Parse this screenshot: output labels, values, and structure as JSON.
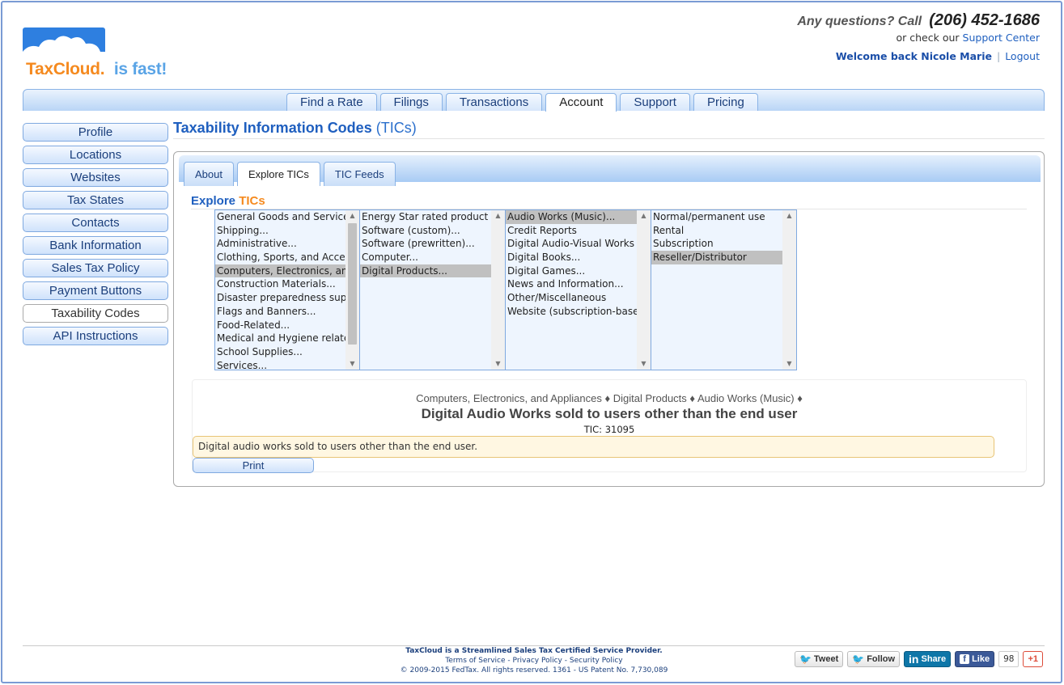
{
  "header": {
    "brand_tax": "TaxCloud",
    "brand_reg": ".",
    "brand_tagline": "is fast!",
    "questions": "Any questions? Call",
    "phone": "(206) 452-1686",
    "check_prefix": "or check our",
    "support_center": "Support Center",
    "welcome": "Welcome back Nicole Marie",
    "logout": "Logout"
  },
  "nav": {
    "tabs": [
      {
        "label": "Find a Rate"
      },
      {
        "label": "Filings"
      },
      {
        "label": "Transactions"
      },
      {
        "label": "Account"
      },
      {
        "label": "Support"
      },
      {
        "label": "Pricing"
      }
    ],
    "active": "Account"
  },
  "sidebar": {
    "items": [
      {
        "label": "Profile"
      },
      {
        "label": "Locations"
      },
      {
        "label": "Websites"
      },
      {
        "label": "Tax States"
      },
      {
        "label": "Contacts"
      },
      {
        "label": "Bank Information"
      },
      {
        "label": "Sales Tax Policy"
      },
      {
        "label": "Payment Buttons"
      },
      {
        "label": "Taxability Codes"
      },
      {
        "label": "API Instructions"
      }
    ],
    "active": "Taxability Codes"
  },
  "main": {
    "title": "Taxability Information Codes",
    "title_suffix": "(TICs)",
    "subtabs": [
      {
        "label": "About"
      },
      {
        "label": "Explore TICs"
      },
      {
        "label": "TIC Feeds"
      }
    ],
    "active_subtab": "Explore TICs",
    "explore_prefix": "Explore",
    "explore_suffix": "TICs"
  },
  "lists": {
    "col1": [
      "General Goods and Services",
      "Shipping...",
      "Administrative...",
      "Clothing, Sports, and Acces",
      "Computers, Electronics, anc",
      "Construction Materials...",
      "Disaster preparedness suppl",
      "Flags and Banners...",
      "Food-Related...",
      "Medical and Hygiene relate",
      "School Supplies...",
      "Services..."
    ],
    "col1_selected": 4,
    "col2": [
      "Energy Star rated product",
      "Software (custom)...",
      "Software (prewritten)...",
      "Computer...",
      "Digital Products..."
    ],
    "col2_selected": 4,
    "col3": [
      "Audio Works (Music)...",
      "Credit Reports",
      "Digital Audio-Visual Works",
      "Digital Books...",
      "Digital Games...",
      "News and Information...",
      "Other/Miscellaneous",
      "Website (subscription-basec"
    ],
    "col3_selected": 0,
    "col4": [
      "Normal/permanent use",
      "Rental",
      "Subscription",
      "Reseller/Distributor"
    ],
    "col4_selected": 3
  },
  "detail": {
    "crumb1": "Computers, Electronics, and Appliances",
    "crumb2": "Digital Products",
    "crumb3": "Audio Works (Music)",
    "crumb_sep": "♦",
    "title": "Digital Audio Works sold to users other than the end user",
    "tic_label": "TIC: 31095",
    "description": "Digital audio works sold to users other than the end user.",
    "print": "Print"
  },
  "footer": {
    "line1": "TaxCloud is a Streamlined Sales Tax Certified Service Provider.",
    "terms": "Terms of Service",
    "privacy": "Privacy Policy",
    "security": "Security Policy",
    "copyright": "© 2009-2015 FedTax. All rights reserved.",
    "build": "1361",
    "patent": "US Patent No. 7,730,089",
    "dash": "-"
  },
  "social": {
    "tweet": "Tweet",
    "follow": "Follow",
    "share": "Share",
    "like": "Like",
    "like_count": "98",
    "gplus": "+1",
    "in": "in"
  },
  "colors": {
    "brand_orange": "#f58a1f",
    "brand_blue": "#3c86d8",
    "link": "#1f5fbf",
    "nav_border": "#8ab3e6"
  }
}
